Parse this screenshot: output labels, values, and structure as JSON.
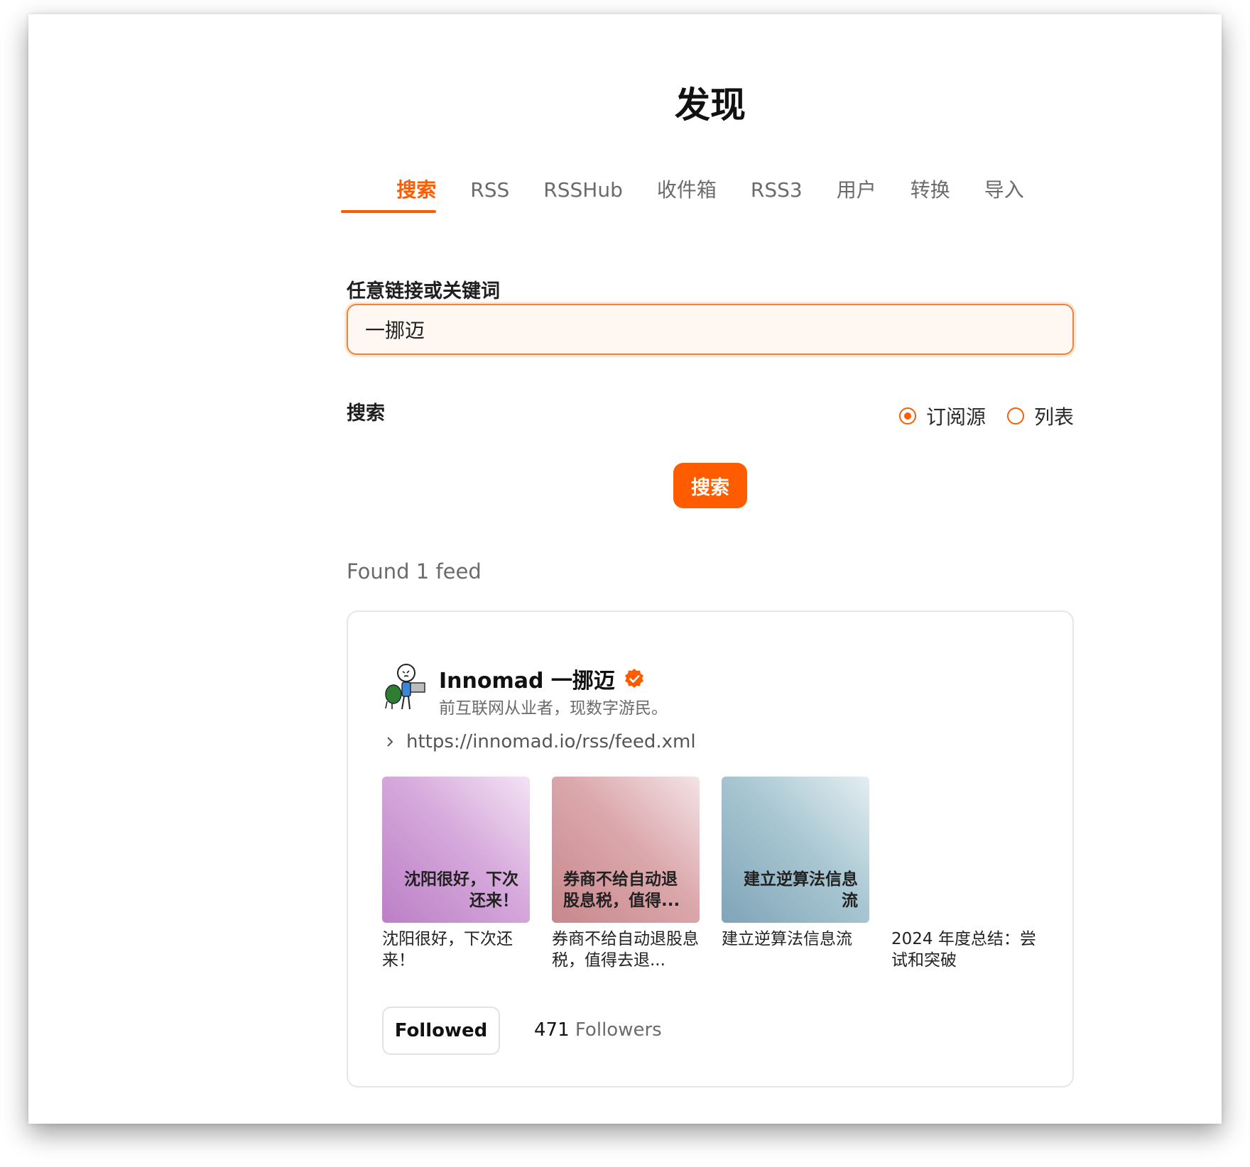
{
  "page": {
    "title": "发现"
  },
  "tabs": [
    {
      "label": "搜索",
      "active": true
    },
    {
      "label": "RSS"
    },
    {
      "label": "RSSHub"
    },
    {
      "label": "收件箱"
    },
    {
      "label": "RSS3"
    },
    {
      "label": "用户"
    },
    {
      "label": "转换"
    },
    {
      "label": "导入"
    }
  ],
  "form": {
    "field_label": "任意链接或关键词",
    "input_value": "一挪迈",
    "search_label": "搜索",
    "radio_options": [
      {
        "label": "订阅源",
        "selected": true
      },
      {
        "label": "列表",
        "selected": false
      }
    ],
    "search_button": "搜索"
  },
  "results": {
    "found_text": "Found 1 feed",
    "feed": {
      "title": "Innomad 一挪迈",
      "description": "前互联网从业者，现数字游民。",
      "url": "https://innomad.io/rss/feed.xml",
      "entries": [
        {
          "thumb_text": "沈阳很好，下次还来！",
          "title": "沈阳很好，下次还来！"
        },
        {
          "thumb_text": "券商不给自动退股息税，值得...",
          "title": "券商不给自动退股息税，值得去退..."
        },
        {
          "thumb_text": "建立逆算法信息流",
          "title": "建立逆算法信息流"
        },
        {
          "title": "2024 年度总结：尝试和突破"
        }
      ],
      "followed_label": "Followed",
      "followers_count": "471",
      "followers_label": "Followers"
    }
  },
  "colors": {
    "accent": "#ff5c00"
  }
}
